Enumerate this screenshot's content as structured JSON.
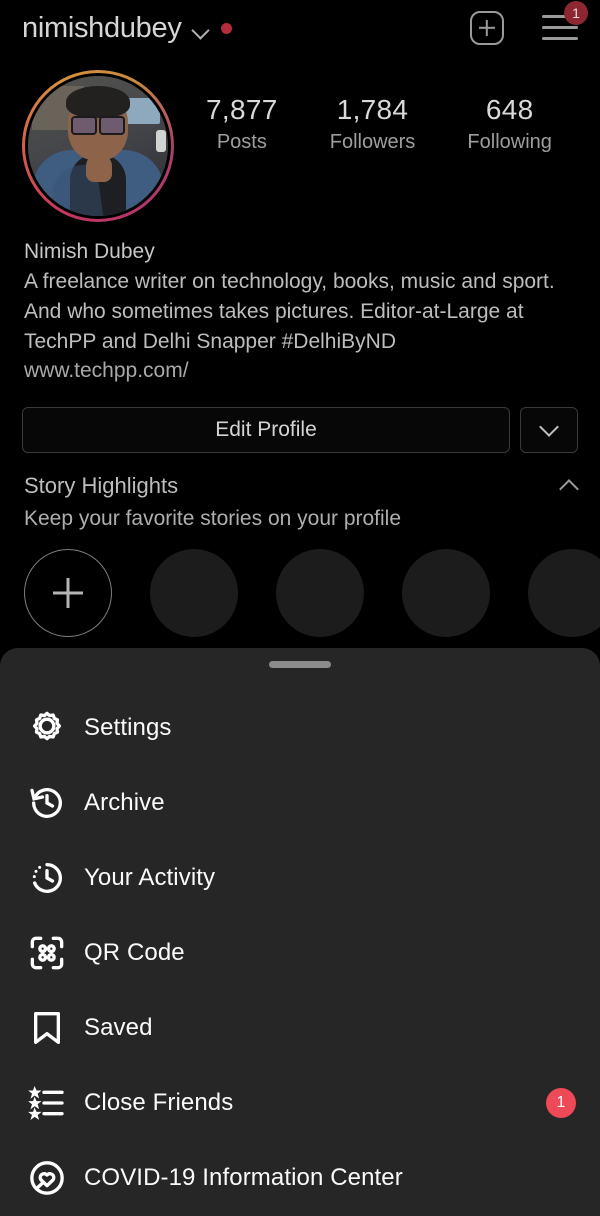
{
  "topbar": {
    "username": "nimishdubey",
    "chevron_icon": "chevron-down-icon",
    "status_dot_color": "#b42d3a",
    "add_icon": "plus-square-icon",
    "menu_icon": "hamburger-menu-icon",
    "menu_badge": "1"
  },
  "profile": {
    "avatar_alt": "profile-photo",
    "stats": [
      {
        "value": "7,877",
        "label": "Posts"
      },
      {
        "value": "1,784",
        "label": "Followers"
      },
      {
        "value": "648",
        "label": "Following"
      }
    ],
    "display_name": "Nimish Dubey",
    "bio_lines": [
      "A freelance writer on technology, books, music and sport.",
      "And who sometimes takes pictures. Editor-at-Large at",
      "TechPP and Delhi Snapper #DelhiByND"
    ],
    "website": "www.techpp.com/"
  },
  "actions": {
    "edit_profile_label": "Edit Profile",
    "dropdown_icon": "chevron-down-icon"
  },
  "highlights": {
    "title": "Story Highlights",
    "subtitle": "Keep your favorite stories on your profile",
    "collapse_icon": "chevron-up-icon",
    "new_icon": "plus-icon",
    "placeholder_count": 4
  },
  "sheet": {
    "handle": "drag-handle",
    "items": [
      {
        "label": "Settings",
        "icon": "gear-icon",
        "badge": null
      },
      {
        "label": "Archive",
        "icon": "archive-clock-icon",
        "badge": null
      },
      {
        "label": "Your Activity",
        "icon": "activity-clock-icon",
        "badge": null
      },
      {
        "label": "QR Code",
        "icon": "qr-code-icon",
        "badge": null
      },
      {
        "label": "Saved",
        "icon": "bookmark-icon",
        "badge": null
      },
      {
        "label": "Close Friends",
        "icon": "close-friends-list-icon",
        "badge": "1"
      },
      {
        "label": "COVID-19 Information Center",
        "icon": "heart-circle-icon",
        "badge": null
      }
    ],
    "badge_color": "#ED4956"
  }
}
